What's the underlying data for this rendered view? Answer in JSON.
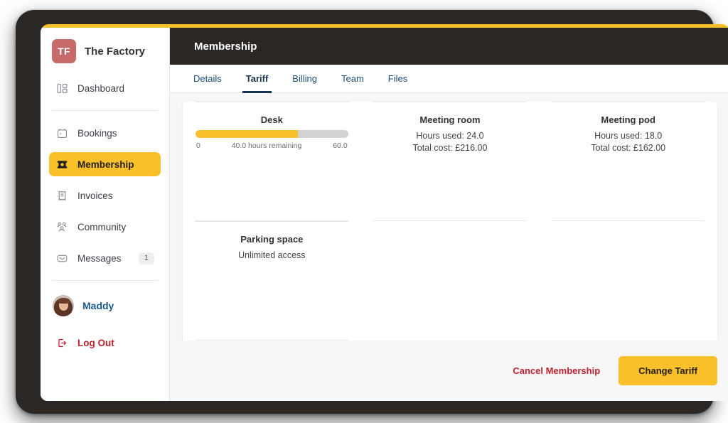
{
  "brand": {
    "initials": "TF",
    "name": "The Factory"
  },
  "sidebar": {
    "items": [
      {
        "label": "Dashboard",
        "icon": "dashboard-icon",
        "badge": null,
        "active": false
      },
      {
        "label": "Bookings",
        "icon": "calendar-icon",
        "badge": null,
        "active": false
      },
      {
        "label": "Membership",
        "icon": "ticket-icon",
        "badge": null,
        "active": true
      },
      {
        "label": "Invoices",
        "icon": "receipt-icon",
        "badge": null,
        "active": false
      },
      {
        "label": "Community",
        "icon": "people-icon",
        "badge": null,
        "active": false
      },
      {
        "label": "Messages",
        "icon": "envelope-icon",
        "badge": "1",
        "active": false
      }
    ],
    "user": {
      "name": "Maddy"
    },
    "logout": {
      "label": "Log Out"
    }
  },
  "topbar": {
    "title": "Membership"
  },
  "tabs": [
    {
      "label": "Details",
      "active": false
    },
    {
      "label": "Tariff",
      "active": true
    },
    {
      "label": "Billing",
      "active": false
    },
    {
      "label": "Team",
      "active": false
    },
    {
      "label": "Files",
      "active": false
    }
  ],
  "tariff_cards": [
    {
      "title": "Desk",
      "type": "progress",
      "progress": {
        "min_label": "0",
        "mid_label": "40.0 hours remaining",
        "max_label": "60.0",
        "fill_percent": 67
      }
    },
    {
      "title": "Meeting room",
      "type": "text",
      "lines": [
        "Hours used: 24.0",
        "Total cost: £216.00"
      ]
    },
    {
      "title": "Meeting pod",
      "type": "text",
      "lines": [
        "Hours used: 18.0",
        "Total cost: £162.00"
      ]
    },
    {
      "title": "Parking space",
      "type": "text",
      "lines": [
        "Unlimited access"
      ]
    }
  ],
  "footer": {
    "cancel_label": "Cancel Membership",
    "change_label": "Change Tariff"
  },
  "colors": {
    "accent_yellow": "#f9c02a",
    "header_dark": "#2b2725",
    "danger_red": "#c0202f",
    "link_blue": "#1d5a8a",
    "tab_active": "#16334f",
    "logo_red": "#c96a6a"
  }
}
